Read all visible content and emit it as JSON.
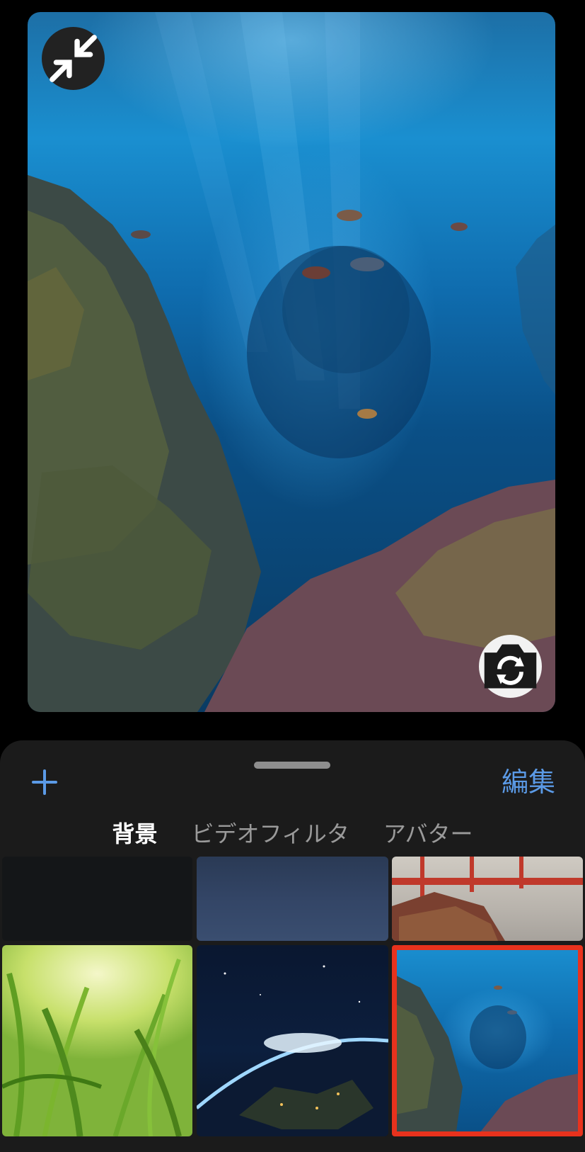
{
  "preview": {
    "minimize_icon": "minimize-arrows-icon",
    "flip_camera_icon": "camera-flip-icon"
  },
  "sheet": {
    "add_icon": "plus-icon",
    "edit_label": "編集",
    "tabs": [
      {
        "label": "背景",
        "active": true
      },
      {
        "label": "ビデオフィルタ",
        "active": false
      },
      {
        "label": "アバター",
        "active": false
      }
    ]
  },
  "colors": {
    "accent": "#5b9ae6",
    "selection": "#e8321d",
    "sheet_bg": "#1b1b1b"
  },
  "backgrounds": [
    {
      "name": "none",
      "selected": false
    },
    {
      "name": "blur",
      "selected": false
    },
    {
      "name": "bridge",
      "selected": false
    },
    {
      "name": "grass",
      "selected": false
    },
    {
      "name": "earth",
      "selected": false
    },
    {
      "name": "aquarium",
      "selected": true
    }
  ]
}
